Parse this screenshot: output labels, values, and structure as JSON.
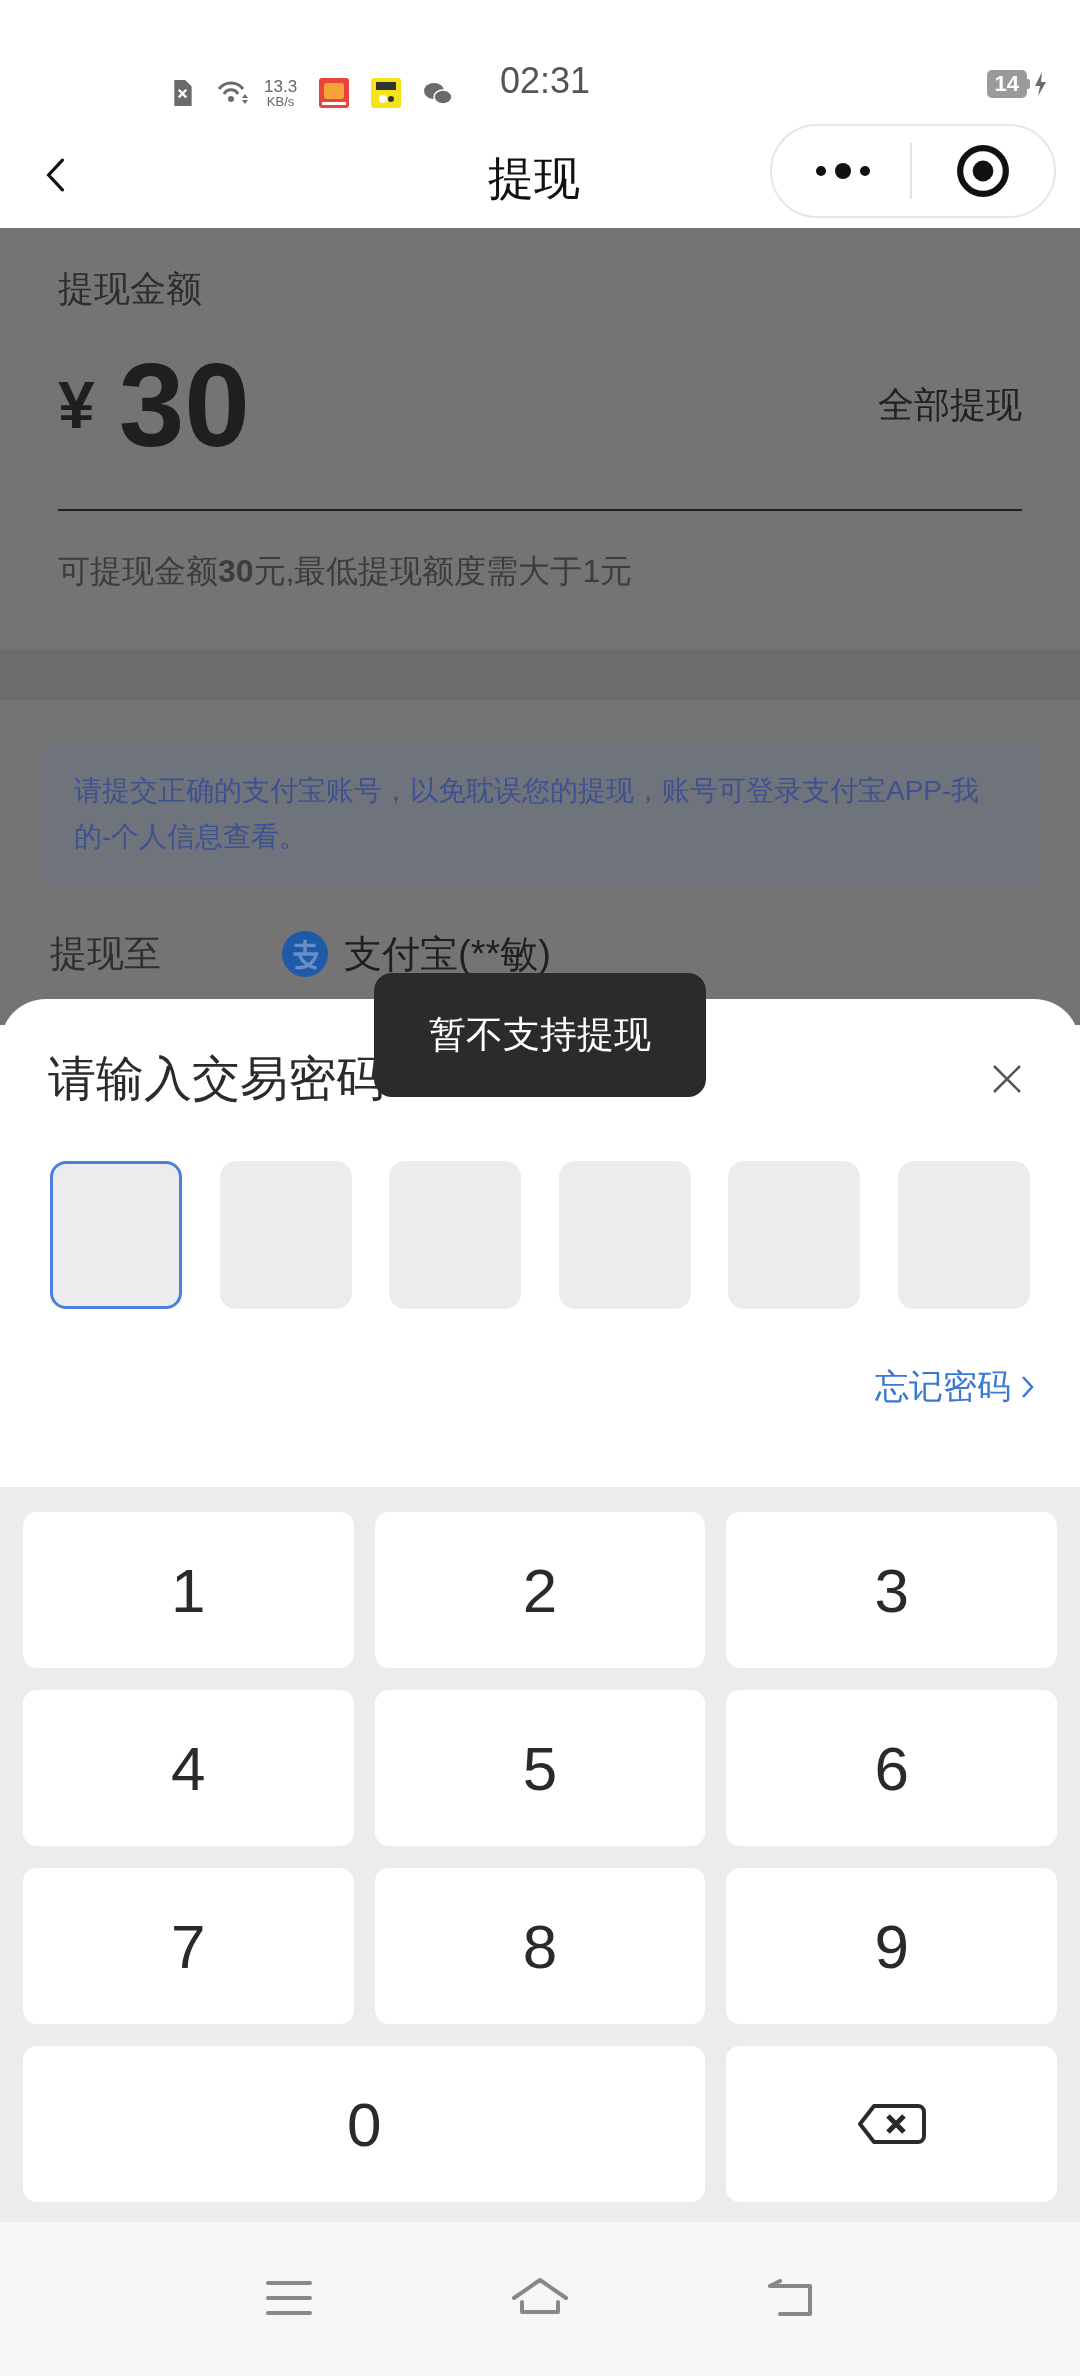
{
  "status_bar": {
    "net_speed": "13.3",
    "net_unit": "KB/s",
    "time": "02:31",
    "battery": "14"
  },
  "nav": {
    "title": "提现"
  },
  "amount": {
    "label": "提现金额",
    "currency": "¥",
    "value": "30",
    "all_button": "全部提现",
    "hint": "可提现金额**30**元,最低提现额度需大于1元"
  },
  "notice": "请提交正确的支付宝账号，以免耽误您的提现，账号可登录支付宝APP-我的-个人信息查看。",
  "destination": {
    "label": "提现至",
    "account": "支付宝(**敏)"
  },
  "toast": "暂不支持提现",
  "password_sheet": {
    "title": "请输入交易密码",
    "boxes": [
      {
        "selected": true
      },
      {
        "selected": false
      },
      {
        "selected": false
      },
      {
        "selected": false
      },
      {
        "selected": false
      },
      {
        "selected": false
      }
    ],
    "forgot": "忘记密码"
  },
  "keypad": [
    {
      "kind": "digit",
      "label": "1"
    },
    {
      "kind": "digit",
      "label": "2"
    },
    {
      "kind": "digit",
      "label": "3"
    },
    {
      "kind": "digit",
      "label": "4"
    },
    {
      "kind": "digit",
      "label": "5"
    },
    {
      "kind": "digit",
      "label": "6"
    },
    {
      "kind": "digit",
      "label": "7"
    },
    {
      "kind": "digit",
      "label": "8"
    },
    {
      "kind": "digit",
      "label": "9"
    },
    {
      "kind": "wide_digit",
      "label": "0"
    },
    {
      "kind": "backspace"
    }
  ]
}
